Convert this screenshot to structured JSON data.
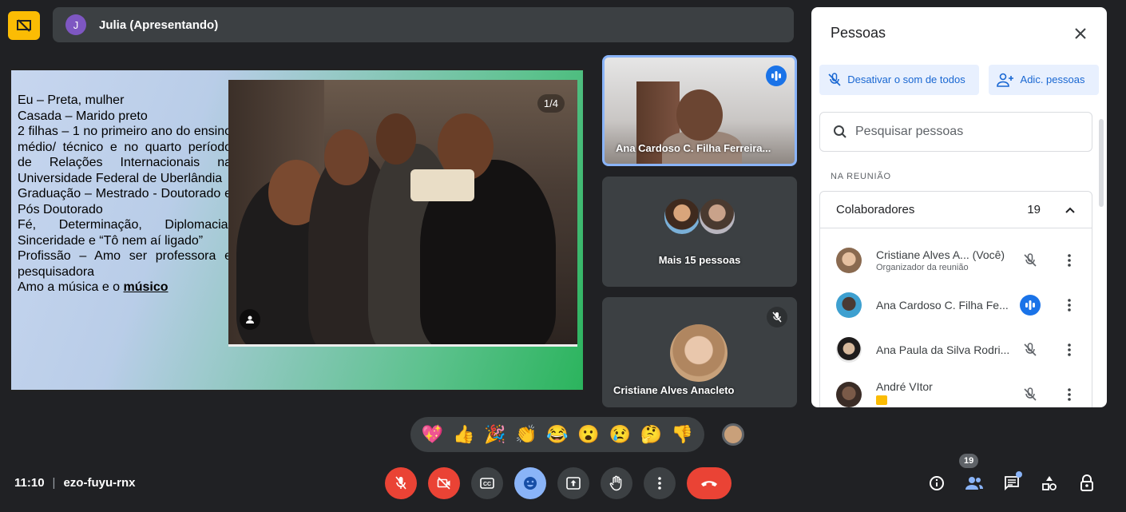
{
  "header": {
    "presenter_initial": "J",
    "presenter_label": "Julia (Apresentando)"
  },
  "slide": {
    "lines": [
      "Eu – Preta, mulher",
      "Casada – Marido preto",
      "2 filhas – 1 no primeiro ano do ensino médio/ técnico e no quarto período de Relações Internacionais na Universidade Federal de Uberlândia",
      "Graduação – Mestrado - Doutorado e Pós Doutorado",
      "Fé, Determinação, Diplomacia, Sinceridade e “Tô nem aí ligado”",
      "Profissão – Amo ser professora e pesquisadora"
    ],
    "last_line_prefix": "Amo a música e o ",
    "last_line_emphasis": "músico",
    "photo_counter": "1/4"
  },
  "tiles": [
    {
      "name": "Ana Cardoso C. Filha Ferreira...",
      "status": "speaking"
    },
    {
      "name": "Mais 15 pessoas",
      "status": "group"
    },
    {
      "name": "Cristiane Alves Anacleto",
      "status": "muted"
    }
  ],
  "reactions": [
    "💖",
    "👍",
    "🎉",
    "👏",
    "😂",
    "😮",
    "😢",
    "🤔",
    "👎"
  ],
  "footer": {
    "time": "11:10",
    "meeting_code": "ezo-fuyu-rnx",
    "participant_count": "19"
  },
  "panel": {
    "title": "Pessoas",
    "mute_all_label": "Desativar o som de todos",
    "add_people_label": "Adic. pessoas",
    "search_placeholder": "Pesquisar pessoas",
    "section_label": "NA REUNIÃO",
    "group_title": "Colaboradores",
    "group_count": "19",
    "people": [
      {
        "name": "Cristiane Alves A... (Você)",
        "role": "Organizador da reunião",
        "mic": "muted"
      },
      {
        "name": "Ana Cardoso C. Filha Fe...",
        "role": "",
        "mic": "speaking"
      },
      {
        "name": "Ana Paula da Silva Rodri...",
        "role": "",
        "mic": "muted"
      },
      {
        "name": "André VItor",
        "role": "",
        "mic": "muted"
      }
    ]
  },
  "colors": {
    "background": "#202124",
    "surface": "#3c4043",
    "accent_blue": "#1a73e8",
    "danger_red": "#ea4335",
    "present_yellow": "#fbbc04"
  }
}
